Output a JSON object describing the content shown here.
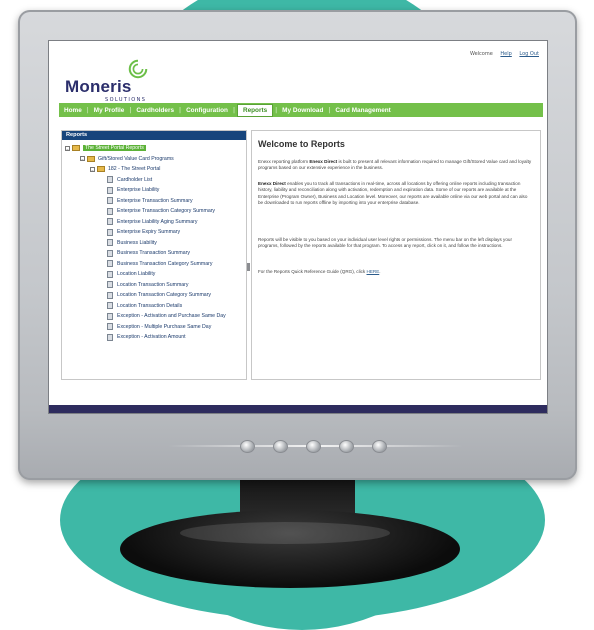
{
  "header": {
    "welcome": "Welcome",
    "help": "Help",
    "logout": "Log Out"
  },
  "logo": {
    "name": "Moneris",
    "sub": "SOLUTIONS",
    "mark_color": "#6cbf48",
    "text_color": "#2b2e6b"
  },
  "nav": {
    "items": [
      "Home",
      "My Profile",
      "Cardholders",
      "Configuration",
      "Reports",
      "My Download",
      "Card Management"
    ],
    "active": "Reports",
    "bar_color": "#74c04a"
  },
  "sidebar": {
    "title": "Reports",
    "root": "The Street Portal Reports",
    "group": "Gift/Stored Value Card Programs",
    "program": "182 - The Street Portal",
    "reports": [
      "Cardholder List",
      "Enterprise Liability",
      "Enterprise Transaction Summary",
      "Enterprise Transaction Category Summary",
      "Enterprise Liability Aging Summary",
      "Enterprise Expiry Summary",
      "Business Liability",
      "Business Transaction Summary",
      "Business Transaction Category Summary",
      "Location Liability",
      "Location Transaction Summary",
      "Location Transaction Category Summary",
      "Location Transaction Details",
      "Exception - Activation and Purchase Same Day",
      "Exception - Multiple Purchase Same Day",
      "Exception - Activation Amount"
    ]
  },
  "main": {
    "title": "Welcome to Reports",
    "p1_pre": "Enexx reporting platform ",
    "p1_bold": "Enexx Direct",
    "p1_post": " is built to present all relevant information required to manage Gift/Stored Value card and loyalty programs based on our extensive experience in the business.",
    "p2_bold": "Enexx Direct",
    "p2_post": " enables you to track all transactions in real-time, across all locations by offering online reports including transaction history, liability and reconciliation along with activation, redemption and expiration data. Some of our reports are available at the Enterprise (Program Owner), Business and Location level. Moreover, our reports are available online via our web portal and can also be downloaded to run reports offline by importing into your enterprise database.",
    "p3": "Reports will be visible to you based on your individual user level rights or permissions. The menu bar on the left displays your programs, followed by the reports available for that program. To access any report, click on it, and follow the instructions.",
    "p4_pre": "For the Reports Quick Reference Guide (QRG), click ",
    "p4_link": "HERE",
    "p4_post": "."
  },
  "colors": {
    "background_circle": "#3eb8a6",
    "panel_header": "#17457c",
    "screen_footer": "#2e2c5e"
  }
}
